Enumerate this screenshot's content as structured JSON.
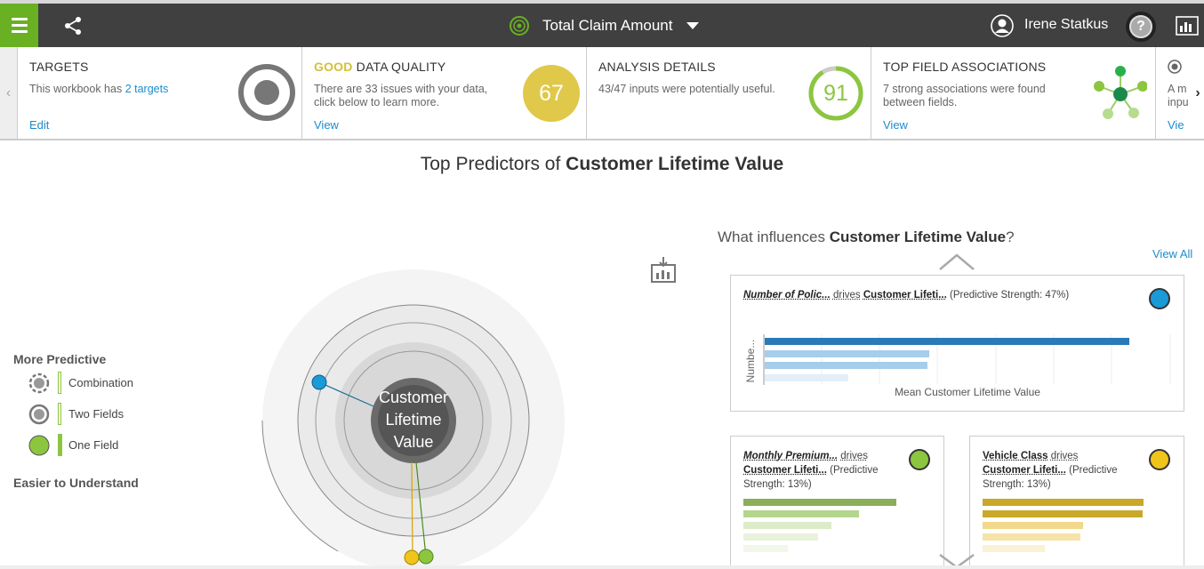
{
  "topbar": {
    "title": "Total Claim Amount",
    "user_name": "Irene Statkus",
    "help_label": "?",
    "icons": {
      "menu": "hamburger-menu-icon",
      "share": "share-icon",
      "title": "target-radar-icon",
      "user": "user-avatar-icon",
      "report": "report-icon"
    }
  },
  "cards": {
    "prev_label": "‹",
    "next_label": "›",
    "targets": {
      "title": "TARGETS",
      "desc_prefix": "This workbook has ",
      "desc_link": "2 targets",
      "link": "Edit"
    },
    "quality": {
      "title_good": "GOOD",
      "title_rest": " DATA QUALITY",
      "desc": "There are 33 issues with your data, click below to learn more.",
      "link": "View",
      "score": "67"
    },
    "analysis": {
      "title": "ANALYSIS DETAILS",
      "desc": "43/47 inputs were potentially useful.",
      "score": "91",
      "score_fraction": 0.91
    },
    "associations": {
      "title": "TOP FIELD ASSOCIATIONS",
      "desc": "7 strong associations were found between fields.",
      "link": "View"
    },
    "partial": {
      "desc": "A m inpu",
      "link": "Vie"
    }
  },
  "main": {
    "title_prefix": "Top Predictors of ",
    "title_bold": "Customer Lifetime Value",
    "center_label_1": "Customer",
    "center_label_2": "Lifetime",
    "center_label_3": "Value"
  },
  "legend": {
    "more": "More Predictive",
    "less": "Easier to Understand",
    "items": [
      {
        "label": "Combination"
      },
      {
        "label": "Two Fields"
      },
      {
        "label": "One Field"
      }
    ]
  },
  "influence": {
    "title_prefix": "What influences ",
    "title_bold": "Customer Lifetime Value",
    "title_suffix": "?",
    "view_all": "View All",
    "cards": [
      {
        "field": "Number of Polic...",
        "drives": "drives",
        "target": "Customer Lifeti...",
        "strength": "(Predictive Strength: 47%)",
        "color": "#1a9ad6",
        "ylabel": "Numbe...",
        "xlabel": "Mean Customer Lifetime Value"
      },
      {
        "field": "Monthly Premium...",
        "drives": "drives",
        "target": "Customer Lifeti...",
        "strength": "(Predictive",
        "strength2": "Strength: 13%)",
        "color": "#6ab023"
      },
      {
        "field": "Vehicle Class",
        "drives": "drives",
        "target": "Customer Lifeti...",
        "strength": "(Predictive",
        "strength2": "Strength: 13%)",
        "color": "#f0c419"
      }
    ]
  },
  "colors": {
    "brand_green": "#6ab023",
    "topbar": "#404040",
    "quality_yellow": "#e0c84a",
    "analysis_green": "#8cc63f",
    "link_blue": "#1a8ccc"
  }
}
